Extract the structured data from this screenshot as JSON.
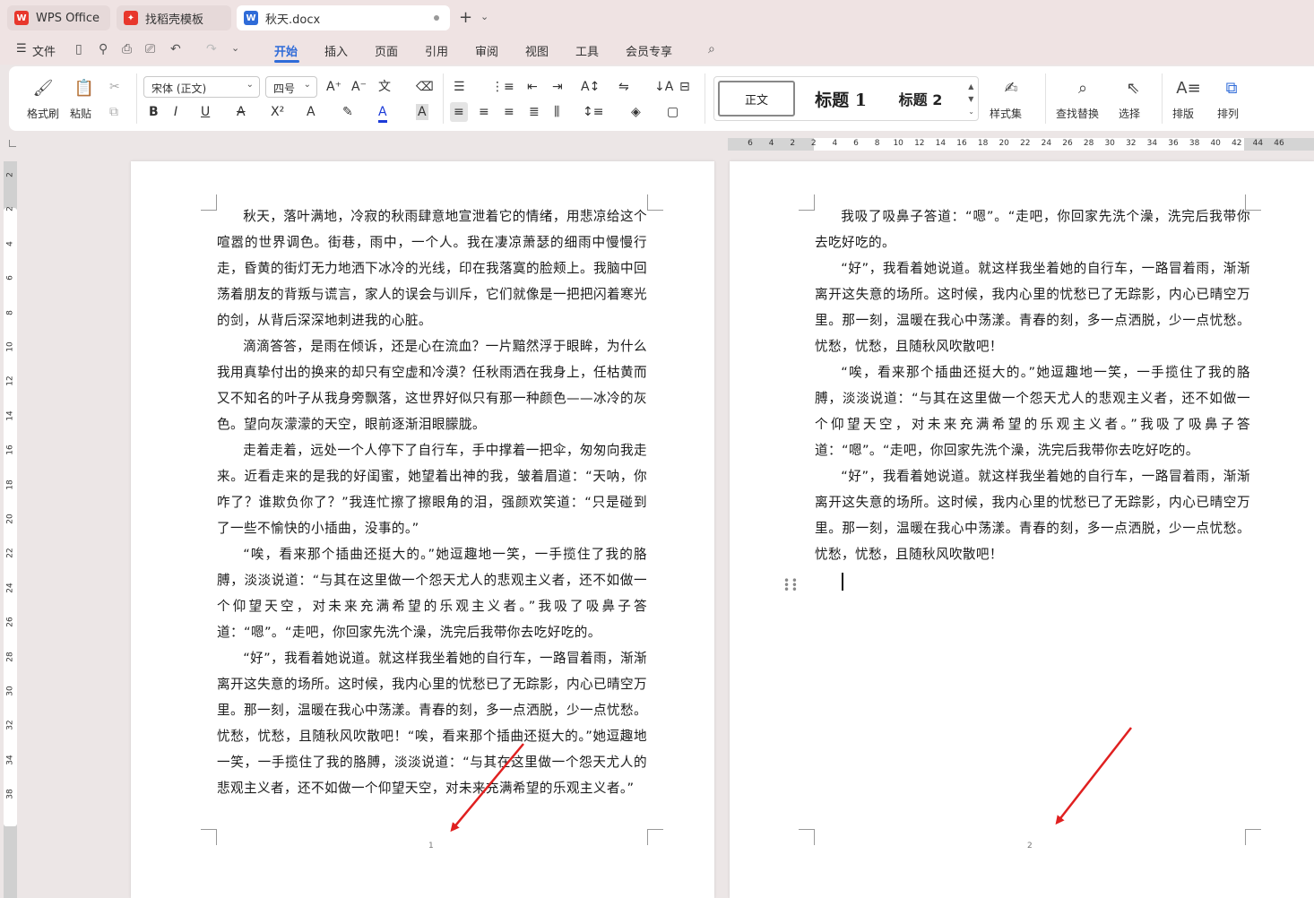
{
  "tabs": [
    {
      "label": "WPS Office",
      "icon": "wps-logo-icon"
    },
    {
      "label": "找稻壳模板",
      "icon": "docer-icon"
    },
    {
      "label": "秋天.docx",
      "icon": "word-doc-icon"
    }
  ],
  "menu": {
    "file": "文件",
    "items": [
      "开始",
      "插入",
      "页面",
      "引用",
      "审阅",
      "视图",
      "工具",
      "会员专享"
    ],
    "active": "开始"
  },
  "ribbon": {
    "format_painter": "格式刷",
    "paste": "粘贴",
    "font_name": "宋体 (正文)",
    "font_size": "四号",
    "style_normal": "正文",
    "style_h1": "标题 1",
    "style_h2": "标题 2",
    "style_set": "样式集",
    "find_replace": "查找替换",
    "select": "选择",
    "layout": "排版",
    "arrange": "排列"
  },
  "hruler_ticks": [
    "6",
    "4",
    "2",
    "2",
    "4",
    "6",
    "8",
    "10",
    "12",
    "14",
    "16",
    "18",
    "20",
    "22",
    "24",
    "26",
    "28",
    "30",
    "32",
    "34",
    "36",
    "38",
    "40",
    "42",
    "44",
    "46"
  ],
  "vruler_ticks": [
    "2",
    "2",
    "4",
    "6",
    "8",
    "10",
    "12",
    "14",
    "16",
    "18",
    "20",
    "22",
    "24",
    "26",
    "28",
    "30",
    "32",
    "34",
    "38"
  ],
  "page1": {
    "paragraphs": [
      "秋天，落叶满地，冷寂的秋雨肆意地宣泄着它的情绪，用悲凉给这个喧嚣的世界调色。街巷，雨中，一个人。我在凄凉萧瑟的细雨中慢慢行走，昏黄的街灯无力地洒下冰冷的光线，印在我落寞的脸颊上。我脑中回荡着朋友的背叛与谎言，家人的误会与训斥，它们就像是一把把闪着寒光的剑，从背后深深地刺进我的心脏。",
      "滴滴答答，是雨在倾诉，还是心在流血？一片黯然浮于眼眸，为什么我用真挚付出的换来的却只有空虚和冷漠？任秋雨洒在我身上，任枯黄而又不知名的叶子从我身旁飘落，这世界好似只有那一种颜色——冰冷的灰色。望向灰濛濛的天空，眼前逐渐泪眼朦胧。",
      "走着走着，远处一个人停下了自行车，手中撑着一把伞，匆匆向我走来。近看走来的是我的好闺蜜，她望着出神的我，皱着眉道：“天呐，你咋了？谁欺负你了？”我连忙擦了擦眼角的泪，强颜欢笑道：“只是碰到了一些不愉快的小插曲，没事的。”",
      "“唉，看来那个插曲还挺大的。”她逗趣地一笑，一手揽住了我的胳膊，淡淡说道：“与其在这里做一个怨天尤人的悲观主义者，还不如做一个仰望天空，对未来充满希望的乐观主义者。”我吸了吸鼻子答道：“嗯”。“走吧，你回家先洗个澡，洗完后我带你去吃好吃的。",
      "“好”，我看着她说道。就这样我坐着她的自行车，一路冒着雨，渐渐离开这失意的场所。这时候，我内心里的忧愁已了无踪影，内心已晴空万里。那一刻，温暖在我心中荡漾。青春的刻，多一点洒脱，少一点忧愁。忧愁，忧愁，且随秋风吹散吧！“唉，看来那个插曲还挺大的。”她逗趣地一笑，一手揽住了我的胳膊，淡淡说道：“与其在这里做一个怨天尤人的悲观主义者，还不如做一个仰望天空，对未来充满希望的乐观主义者。”"
    ],
    "page_number": "1"
  },
  "page2": {
    "paragraphs": [
      "我吸了吸鼻子答道：“嗯”。“走吧，你回家先洗个澡，洗完后我带你去吃好吃的。",
      "“好”，我看着她说道。就这样我坐着她的自行车，一路冒着雨，渐渐离开这失意的场所。这时候，我内心里的忧愁已了无踪影，内心已晴空万里。那一刻，温暖在我心中荡漾。青春的刻，多一点洒脱，少一点忧愁。忧愁，忧愁，且随秋风吹散吧！",
      "“唉，看来那个插曲还挺大的。”她逗趣地一笑，一手揽住了我的胳膊，淡淡说道：“与其在这里做一个怨天尤人的悲观主义者，还不如做一个仰望天空，对未来充满希望的乐观主义者。”我吸了吸鼻子答道：“嗯”。“走吧，你回家先洗个澡，洗完后我带你去吃好吃的。",
      "“好”，我看着她说道。就这样我坐着她的自行车，一路冒着雨，渐渐离开这失意的场所。这时候，我内心里的忧愁已了无踪影，内心已晴空万里。那一刻，温暖在我心中荡漾。青春的刻，多一点洒脱，少一点忧愁。忧愁，忧愁，且随秋风吹散吧！"
    ],
    "page_number": "2"
  },
  "colors": {
    "accent": "#2f6bd8",
    "annotation_arrow": "#e02020",
    "wps_red": "#e8372c",
    "word_blue": "#2f6bd8"
  }
}
